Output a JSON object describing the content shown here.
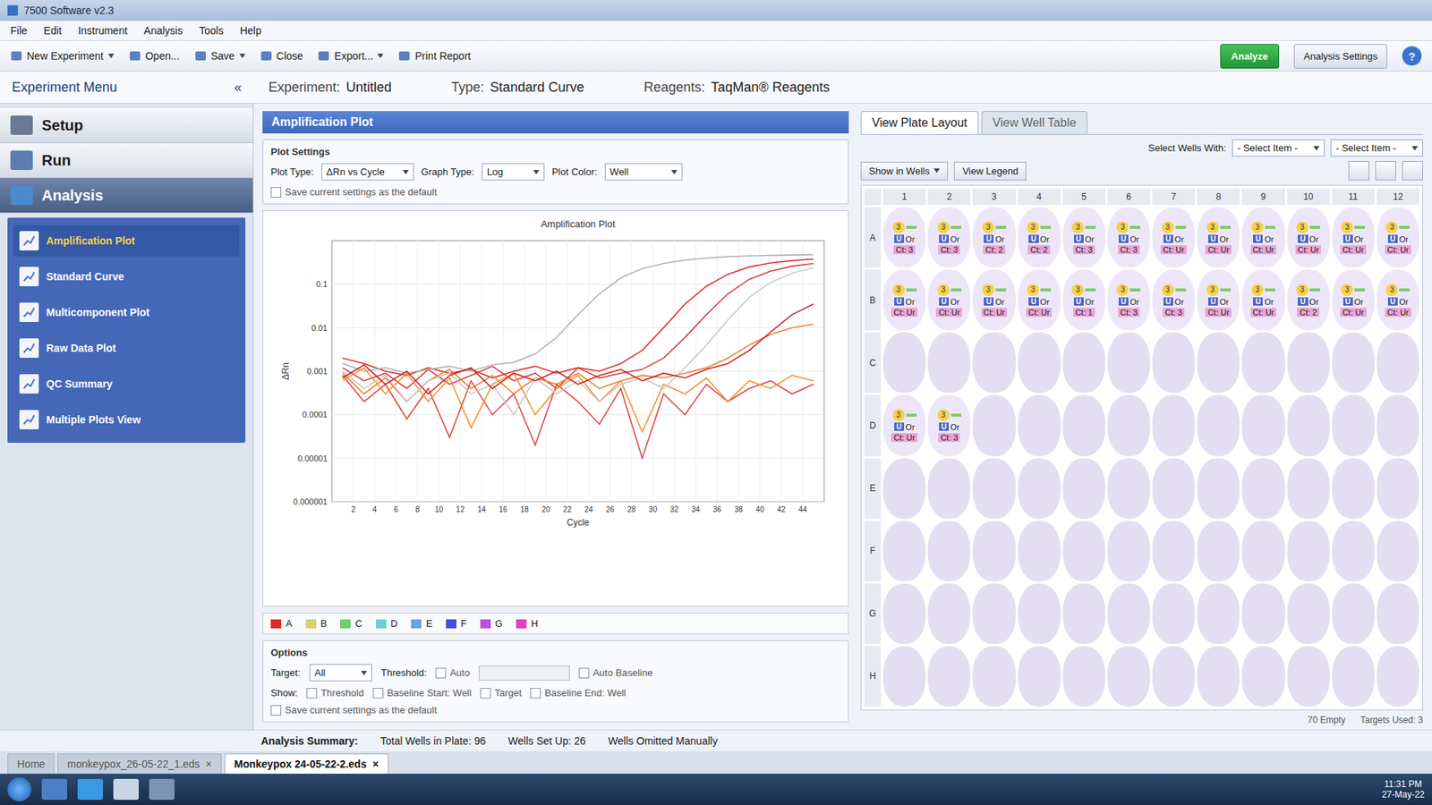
{
  "window": {
    "title": "7500 Software v2.3"
  },
  "menu": [
    "File",
    "Edit",
    "Instrument",
    "Analysis",
    "Tools",
    "Help"
  ],
  "toolbar": [
    {
      "label": "New Experiment",
      "dropdown": true
    },
    {
      "label": "Open...",
      "dropdown": false
    },
    {
      "label": "Save",
      "dropdown": true
    },
    {
      "label": "Close",
      "dropdown": false
    },
    {
      "label": "Export...",
      "dropdown": true
    },
    {
      "label": "Print Report",
      "dropdown": false
    }
  ],
  "actions": {
    "analyze": "Analyze",
    "settings": "Analysis Settings",
    "help": "?"
  },
  "experiment": {
    "label": "Experiment:",
    "name": "Untitled",
    "type_label": "Type:",
    "type": "Standard Curve",
    "reagents_label": "Reagents:",
    "reagents": "TaqMan® Reagents"
  },
  "sidebar": {
    "title": "Experiment Menu",
    "collapse": "«",
    "sections": [
      {
        "label": "Setup",
        "selected": false
      },
      {
        "label": "Run",
        "selected": false
      },
      {
        "label": "Analysis",
        "selected": true
      }
    ],
    "items": [
      {
        "label": "Amplification Plot",
        "selected": true
      },
      {
        "label": "Standard Curve",
        "selected": false
      },
      {
        "label": "Multicomponent Plot",
        "selected": false
      },
      {
        "label": "Raw Data Plot",
        "selected": false
      },
      {
        "label": "QC Summary",
        "selected": false
      },
      {
        "label": "Multiple Plots View",
        "selected": false
      }
    ]
  },
  "plot_panel": {
    "title": "Amplification Plot",
    "settings_title": "Plot Settings",
    "plot_type_label": "Plot Type:",
    "plot_type": "ΔRn vs Cycle",
    "graph_type_label": "Graph Type:",
    "graph_type": "Log",
    "plot_color_label": "Plot Color:",
    "plot_color": "Well",
    "save_default": {
      "label": "Save current settings as the default",
      "checked": false
    }
  },
  "chart": {
    "title": "Amplification Plot",
    "x_label": "Cycle",
    "y_label": "ΔRn",
    "y_ticks": [
      "0.1",
      "0.01",
      "0.001",
      "0.0001",
      "0.00001",
      "0.000001"
    ],
    "x_ticks": [
      "2",
      "4",
      "6",
      "8",
      "10",
      "12",
      "14",
      "16",
      "18",
      "20",
      "22",
      "24",
      "26",
      "28",
      "30",
      "32",
      "34",
      "36",
      "38",
      "40",
      "42",
      "44"
    ],
    "series": [
      {
        "color": "#e02a2a",
        "values": [
          0.002,
          0.0015,
          0.001,
          0.0008,
          0.0012,
          0.0009,
          0.0011,
          0.0007,
          0.001,
          0.0013,
          0.0009,
          0.0012,
          0.001,
          0.0015,
          0.003,
          0.01,
          0.035,
          0.09,
          0.17,
          0.25,
          0.31,
          0.35,
          0.38
        ]
      },
      {
        "color": "#d83838",
        "values": [
          0.0012,
          0.0006,
          0.0009,
          0.0004,
          0.0011,
          0.0005,
          0.0008,
          0.0013,
          0.0006,
          0.0009,
          0.0004,
          0.0012,
          0.0007,
          0.0009,
          0.0011,
          0.002,
          0.006,
          0.02,
          0.06,
          0.13,
          0.2,
          0.26,
          0.3
        ]
      },
      {
        "color": "#f07a2a",
        "values": [
          0.0009,
          0.0003,
          0.0007,
          0.0002,
          0.0006,
          0.0011,
          0.0004,
          0.0008,
          0.0003,
          0.0007,
          0.0005,
          0.0009,
          0.0004,
          0.0006,
          0.0008,
          0.0007,
          0.0009,
          0.0012,
          0.002,
          0.004,
          0.007,
          0.01,
          0.012
        ]
      },
      {
        "color": "#b0b0b0",
        "values": [
          0.0015,
          0.001,
          0.0012,
          0.0009,
          0.0011,
          0.0013,
          0.001,
          0.0014,
          0.0016,
          0.0025,
          0.006,
          0.02,
          0.06,
          0.14,
          0.23,
          0.3,
          0.36,
          0.4,
          0.43,
          0.45,
          0.46,
          0.47,
          0.48
        ]
      },
      {
        "color": "#e04040",
        "values": [
          0.0008,
          0.0002,
          0.0005,
          8e-05,
          0.0004,
          3e-05,
          0.0006,
          0.0001,
          0.0003,
          2e-05,
          0.0005,
          0.0002,
          6e-05,
          0.0004,
          1e-05,
          0.0003,
          0.0001,
          0.0005,
          0.0002,
          0.0004,
          0.0006,
          0.0003,
          0.0005
        ]
      },
      {
        "color": "#f0902a",
        "values": [
          0.0006,
          0.0012,
          0.0003,
          0.0009,
          0.0002,
          0.0007,
          5e-05,
          0.0005,
          0.0009,
          0.0001,
          0.0004,
          0.0008,
          0.0002,
          0.0006,
          4e-05,
          0.0005,
          0.0003,
          0.0007,
          0.0002,
          0.0006,
          0.0004,
          0.0008,
          0.0006
        ]
      },
      {
        "color": "#c8c8c8",
        "values": [
          0.001,
          0.0004,
          0.0008,
          0.0002,
          0.0006,
          0.0009,
          0.0003,
          0.0005,
          0.0001,
          0.0007,
          0.0003,
          0.0006,
          0.0002,
          0.0005,
          0.0007,
          0.0004,
          0.0012,
          0.004,
          0.015,
          0.05,
          0.11,
          0.18,
          0.24
        ]
      },
      {
        "color": "#c82020",
        "values": [
          0.0007,
          0.0014,
          0.0005,
          0.001,
          0.0003,
          0.0008,
          0.0012,
          0.0004,
          0.0009,
          0.0006,
          0.001,
          0.0005,
          0.0008,
          0.0011,
          0.0006,
          0.0009,
          0.0007,
          0.0011,
          0.0015,
          0.003,
          0.008,
          0.02,
          0.035
        ]
      }
    ],
    "legend": [
      {
        "label": "A",
        "color": "#e02a2a"
      },
      {
        "label": "B",
        "color": "#d6d070"
      },
      {
        "label": "C",
        "color": "#6cd06c"
      },
      {
        "label": "D",
        "color": "#6cd0d0"
      },
      {
        "label": "E",
        "color": "#6ca0f0"
      },
      {
        "label": "F",
        "color": "#4a4ae0"
      },
      {
        "label": "G",
        "color": "#c050e0"
      },
      {
        "label": "H",
        "color": "#e040c0"
      }
    ]
  },
  "options": {
    "title": "Options",
    "target_label": "Target:",
    "target": "All",
    "threshold_label": "Threshold:",
    "auto": {
      "label": "Auto",
      "checked": false
    },
    "auto_baseline": {
      "label": "Auto Baseline",
      "checked": false
    },
    "show_label": "Show:",
    "show": [
      {
        "label": "Threshold",
        "checked": false
      },
      {
        "label": "Baseline Start: Well",
        "checked": false
      },
      {
        "label": "Target",
        "checked": false
      },
      {
        "label": "Baseline End: Well",
        "checked": false
      }
    ],
    "save_default": {
      "label": "Save current settings as the default",
      "checked": false
    }
  },
  "plate": {
    "tabs": [
      {
        "label": "View Plate Layout",
        "selected": true
      },
      {
        "label": "View Well Table",
        "selected": false
      }
    ],
    "select_label": "Select Wells With:",
    "selects": [
      "- Select Item -",
      "- Select Item -"
    ],
    "show_in_wells": "Show in Wells",
    "view_legend": "View Legend",
    "columns": [
      "1",
      "2",
      "3",
      "4",
      "5",
      "6",
      "7",
      "8",
      "9",
      "10",
      "11",
      "12"
    ],
    "rows": [
      {
        "label": "A",
        "wells": [
          {
            "filled": true,
            "count": "3",
            "task": "U",
            "name": "Or",
            "ct": "Ct: 3"
          },
          {
            "filled": true,
            "count": "3",
            "task": "U",
            "name": "Or",
            "ct": "Ct: 3"
          },
          {
            "filled": true,
            "count": "3",
            "task": "U",
            "name": "Or",
            "ct": "Ct: 2"
          },
          {
            "filled": true,
            "count": "3",
            "task": "U",
            "name": "Or",
            "ct": "Ct: 2"
          },
          {
            "filled": true,
            "count": "3",
            "task": "U",
            "name": "Or",
            "ct": "Ct: 3"
          },
          {
            "filled": true,
            "count": "3",
            "task": "U",
            "name": "Or",
            "ct": "Ct: 3"
          },
          {
            "filled": true,
            "count": "3",
            "task": "U",
            "name": "Or",
            "ct": "Ct: Ur"
          },
          {
            "filled": true,
            "count": "3",
            "task": "U",
            "name": "Or",
            "ct": "Ct: Ur"
          },
          {
            "filled": true,
            "count": "3",
            "task": "U",
            "name": "Or",
            "ct": "Ct: Ur"
          },
          {
            "filled": true,
            "count": "3",
            "task": "U",
            "name": "Or",
            "ct": "Ct: Ur"
          },
          {
            "filled": true,
            "count": "3",
            "task": "U",
            "name": "Or",
            "ct": "Ct: Ur"
          },
          {
            "filled": true,
            "count": "3",
            "task": "U",
            "name": "Or",
            "ct": "Ct: Ur"
          }
        ]
      },
      {
        "label": "B",
        "wells": [
          {
            "filled": true,
            "count": "3",
            "task": "U",
            "name": "Or",
            "ct": "Ct: Ur"
          },
          {
            "filled": true,
            "count": "3",
            "task": "U",
            "name": "Or",
            "ct": "Ct: Ur"
          },
          {
            "filled": true,
            "count": "3",
            "task": "U",
            "name": "Or",
            "ct": "Ct: Ur"
          },
          {
            "filled": true,
            "count": "3",
            "task": "U",
            "name": "Or",
            "ct": "Ct: Ur"
          },
          {
            "filled": true,
            "count": "3",
            "task": "U",
            "name": "Or",
            "ct": "Ct: 1"
          },
          {
            "filled": true,
            "count": "3",
            "task": "U",
            "name": "Or",
            "ct": "Ct: 3"
          },
          {
            "filled": true,
            "count": "3",
            "task": "U",
            "name": "Or",
            "ct": "Ct: 3"
          },
          {
            "filled": true,
            "count": "3",
            "task": "U",
            "name": "Or",
            "ct": "Ct: Ur"
          },
          {
            "filled": true,
            "count": "3",
            "task": "U",
            "name": "Or",
            "ct": "Ct: Ur"
          },
          {
            "filled": true,
            "count": "3",
            "task": "U",
            "name": "Or",
            "ct": "Ct: 2"
          },
          {
            "filled": true,
            "count": "3",
            "task": "U",
            "name": "Or",
            "ct": "Ct: Ur"
          },
          {
            "filled": true,
            "count": "3",
            "task": "U",
            "name": "Or",
            "ct": "Ct: Ur"
          }
        ]
      },
      {
        "label": "C",
        "wells": [
          {
            "filled": false
          },
          {
            "filled": false
          },
          {
            "filled": false
          },
          {
            "filled": false
          },
          {
            "filled": false
          },
          {
            "filled": false
          },
          {
            "filled": false
          },
          {
            "filled": false
          },
          {
            "filled": false
          },
          {
            "filled": false
          },
          {
            "filled": false
          },
          {
            "filled": false
          }
        ]
      },
      {
        "label": "D",
        "wells": [
          {
            "filled": true,
            "count": "3",
            "task": "U",
            "name": "Or",
            "ct": "Ct: Ur"
          },
          {
            "filled": true,
            "count": "3",
            "task": "U",
            "name": "Or",
            "ct": "Ct: 3"
          },
          {
            "filled": false
          },
          {
            "filled": false
          },
          {
            "filled": false
          },
          {
            "filled": false
          },
          {
            "filled": false
          },
          {
            "filled": false
          },
          {
            "filled": false
          },
          {
            "filled": false
          },
          {
            "filled": false
          },
          {
            "filled": false
          }
        ]
      },
      {
        "label": "E",
        "wells": [
          {
            "filled": false
          },
          {
            "filled": false
          },
          {
            "filled": false
          },
          {
            "filled": false
          },
          {
            "filled": false
          },
          {
            "filled": false
          },
          {
            "filled": false
          },
          {
            "filled": false
          },
          {
            "filled": false
          },
          {
            "filled": false
          },
          {
            "filled": false
          },
          {
            "filled": false
          }
        ]
      },
      {
        "label": "F",
        "wells": [
          {
            "filled": false
          },
          {
            "filled": false
          },
          {
            "filled": false
          },
          {
            "filled": false
          },
          {
            "filled": false
          },
          {
            "filled": false
          },
          {
            "filled": false
          },
          {
            "filled": false
          },
          {
            "filled": false
          },
          {
            "filled": false
          },
          {
            "filled": false
          },
          {
            "filled": false
          }
        ]
      },
      {
        "label": "G",
        "wells": [
          {
            "filled": false
          },
          {
            "filled": false
          },
          {
            "filled": false
          },
          {
            "filled": false
          },
          {
            "filled": false
          },
          {
            "filled": false
          },
          {
            "filled": false
          },
          {
            "filled": false
          },
          {
            "filled": false
          },
          {
            "filled": false
          },
          {
            "filled": false
          },
          {
            "filled": false
          }
        ]
      },
      {
        "label": "H",
        "wells": [
          {
            "filled": false
          },
          {
            "filled": false
          },
          {
            "filled": false
          },
          {
            "filled": false
          },
          {
            "filled": false
          },
          {
            "filled": false
          },
          {
            "filled": false
          },
          {
            "filled": false
          },
          {
            "filled": false
          },
          {
            "filled": false
          },
          {
            "filled": false
          },
          {
            "filled": false
          }
        ]
      }
    ],
    "empty_count": "70 Empty",
    "targets_used": "Targets Used: 3"
  },
  "summary": {
    "label": "Analysis Summary:",
    "items": [
      "Total Wells in Plate: 96",
      "Wells Set Up: 26",
      "Wells Omitted Manually"
    ]
  },
  "file_tabs": [
    {
      "label": "Home",
      "selected": false,
      "closable": false
    },
    {
      "label": "monkeypox_26-05-22_1.eds",
      "selected": false,
      "closable": true
    },
    {
      "label": "Monkeypox 24-05-22-2.eds",
      "selected": true,
      "closable": true
    }
  ],
  "file_tab_close": "×",
  "taskbar": {
    "time": "11:31 PM",
    "date": "27-May-22"
  }
}
